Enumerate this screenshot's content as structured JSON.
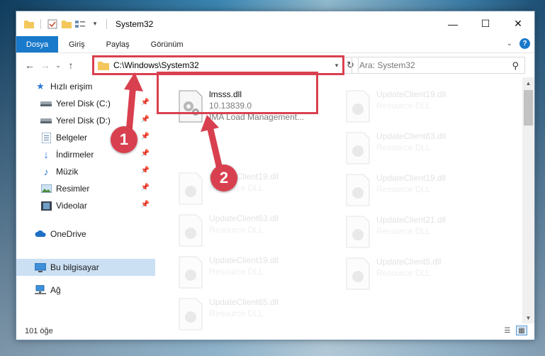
{
  "window": {
    "title": "System32",
    "controls": {
      "minimize": "—",
      "maximize": "☐",
      "close": "✕"
    }
  },
  "ribbon": {
    "tabs": [
      "Dosya",
      "Giriş",
      "Paylaş",
      "Görünüm"
    ],
    "help": "?"
  },
  "address": {
    "path": "C:\\Windows\\System32",
    "search_placeholder": "Ara: System32"
  },
  "sidebar": {
    "quick_access": "Hızlı erişim",
    "items": [
      {
        "label": "Yerel Disk (C:)",
        "icon": "drive-icon",
        "pinned": true
      },
      {
        "label": "Yerel Disk (D:)",
        "icon": "drive-icon",
        "pinned": true
      },
      {
        "label": "Belgeler",
        "icon": "documents-icon",
        "pinned": true
      },
      {
        "label": "İndirmeler",
        "icon": "downloads-icon",
        "pinned": true
      },
      {
        "label": "Müzik",
        "icon": "music-icon",
        "pinned": true
      },
      {
        "label": "Resimler",
        "icon": "pictures-icon",
        "pinned": true
      },
      {
        "label": "Videolar",
        "icon": "videos-icon",
        "pinned": true
      }
    ],
    "onedrive": "OneDrive",
    "this_pc": "Bu bilgisayar",
    "network": "Ağ"
  },
  "files": {
    "highlighted": {
      "name": "lmsss.dll",
      "version": "10.13839.0",
      "description": "IMA Load Management..."
    },
    "faded_left": [
      {
        "name": "UpdateClient19.dll",
        "type": "Resource DLL"
      },
      {
        "name": "UpdateClient63.dll",
        "type": "Resource DLL"
      },
      {
        "name": "UpdateClient19.dll",
        "type": "Resource DLL"
      },
      {
        "name": "UpdateClient65.dll",
        "type": "Resource DLL"
      }
    ],
    "faded_right": [
      {
        "name": "UpdateClient19.dll",
        "type": "Resource DLL"
      },
      {
        "name": "UpdateClient63.dll",
        "type": "Resource DLL"
      },
      {
        "name": "UpdateClient19.dll",
        "type": "Resource DLL"
      },
      {
        "name": "UpdateClient21.dll",
        "type": "Resource DLL"
      },
      {
        "name": "UpdateClient5.dll",
        "type": "Resource DLL"
      }
    ]
  },
  "status": {
    "count": "101 öğe"
  },
  "annotations": {
    "step1": "1",
    "step2": "2",
    "color": "#d9404f"
  }
}
